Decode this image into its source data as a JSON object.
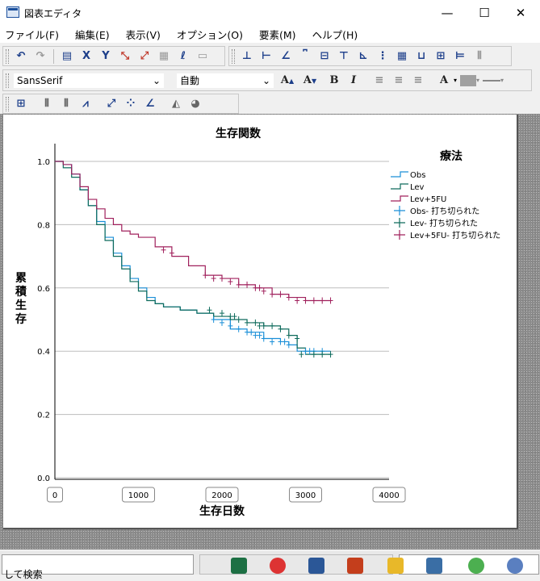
{
  "window": {
    "title": "図表エディタ",
    "min": "—",
    "max": "☐",
    "close": "✕"
  },
  "menu": [
    "ファイル(F)",
    "編集(E)",
    "表示(V)",
    "オプション(O)",
    "要素(M)",
    "ヘルプ(H)"
  ],
  "font_toolbar": {
    "font": "SansSerif",
    "size": "自動",
    "bold": "B",
    "italic": "I",
    "grow": "A",
    "shrink": "A",
    "text_color": "A"
  },
  "taskbar": {
    "search_text": "して検索"
  },
  "colors": {
    "obs": "#1a8fd8",
    "lev": "#0e6b5c",
    "lev5fu": "#a0205c"
  },
  "chart_data": {
    "type": "line",
    "title": "生存関数",
    "xlabel": "生存日数",
    "ylabel": "累積生存",
    "xlim": [
      0,
      4000
    ],
    "ylim": [
      0,
      1.0
    ],
    "xticks": [
      "0",
      "1000",
      "2000",
      "3000",
      "4000"
    ],
    "yticks": [
      "0.0",
      "0.2",
      "0.4",
      "0.6",
      "0.8",
      "1.0"
    ],
    "grid": "horizontal",
    "legend_title": "療法",
    "legend_position": "right",
    "legend": [
      "Obs",
      "Lev",
      "Lev+5FU",
      "Obs- 打ち切られた",
      "Lev- 打ち切られた",
      "Lev+5FU- 打ち切られた"
    ],
    "series": [
      {
        "name": "Obs",
        "color": "#1a8fd8",
        "x": [
          0,
          100,
          200,
          300,
          400,
          500,
          600,
          700,
          800,
          900,
          1000,
          1100,
          1200,
          1300,
          1500,
          1700,
          1900,
          2100,
          2300,
          2500,
          2700,
          2800,
          2900,
          3000,
          3200,
          3300
        ],
        "y": [
          1.0,
          0.99,
          0.96,
          0.91,
          0.86,
          0.81,
          0.76,
          0.71,
          0.67,
          0.63,
          0.6,
          0.57,
          0.55,
          0.54,
          0.53,
          0.52,
          0.5,
          0.47,
          0.46,
          0.44,
          0.43,
          0.42,
          0.4,
          0.4,
          0.4,
          0.4
        ]
      },
      {
        "name": "Lev",
        "color": "#0e6b5c",
        "x": [
          0,
          100,
          200,
          300,
          400,
          500,
          600,
          700,
          800,
          900,
          1000,
          1100,
          1200,
          1300,
          1500,
          1700,
          1900,
          2100,
          2300,
          2500,
          2700,
          2800,
          2900,
          3000,
          3200,
          3300
        ],
        "y": [
          1.0,
          0.98,
          0.95,
          0.91,
          0.86,
          0.8,
          0.75,
          0.7,
          0.66,
          0.62,
          0.59,
          0.56,
          0.55,
          0.54,
          0.53,
          0.52,
          0.51,
          0.5,
          0.49,
          0.48,
          0.47,
          0.45,
          0.41,
          0.39,
          0.39,
          0.39
        ]
      },
      {
        "name": "Lev+5FU",
        "color": "#a0205c",
        "x": [
          0,
          100,
          200,
          300,
          400,
          500,
          600,
          700,
          800,
          900,
          1000,
          1200,
          1400,
          1600,
          1800,
          2000,
          2200,
          2400,
          2600,
          2800,
          3000,
          3200,
          3300
        ],
        "y": [
          1.0,
          0.99,
          0.96,
          0.92,
          0.88,
          0.85,
          0.82,
          0.8,
          0.78,
          0.77,
          0.76,
          0.73,
          0.7,
          0.67,
          0.64,
          0.63,
          0.61,
          0.6,
          0.58,
          0.57,
          0.56,
          0.56,
          0.56
        ]
      }
    ],
    "censored": [
      {
        "name": "Obs- 打ち切られた",
        "color": "#1a8fd8",
        "x": [
          1900,
          2000,
          2100,
          2200,
          2300,
          2350,
          2400,
          2450,
          2500,
          2600,
          2700,
          2750,
          2800,
          3000,
          3050,
          3100,
          3200
        ],
        "y": [
          0.5,
          0.49,
          0.48,
          0.47,
          0.46,
          0.46,
          0.45,
          0.45,
          0.44,
          0.43,
          0.43,
          0.43,
          0.42,
          0.4,
          0.4,
          0.4,
          0.4
        ]
      },
      {
        "name": "Lev- 打ち切られた",
        "color": "#0e6b5c",
        "x": [
          1850,
          2000,
          2100,
          2150,
          2200,
          2300,
          2400,
          2450,
          2500,
          2600,
          2700,
          2800,
          2900,
          2950,
          3100,
          3200,
          3300
        ],
        "y": [
          0.53,
          0.52,
          0.51,
          0.51,
          0.5,
          0.49,
          0.49,
          0.48,
          0.48,
          0.48,
          0.47,
          0.45,
          0.44,
          0.39,
          0.39,
          0.39,
          0.39
        ]
      },
      {
        "name": "Lev+5FU- 打ち切られた",
        "color": "#a0205c",
        "x": [
          1300,
          1400,
          1800,
          1900,
          2000,
          2100,
          2200,
          2300,
          2400,
          2450,
          2500,
          2600,
          2700,
          2800,
          2900,
          3000,
          3100,
          3200,
          3300
        ],
        "y": [
          0.72,
          0.71,
          0.64,
          0.63,
          0.63,
          0.62,
          0.61,
          0.61,
          0.6,
          0.6,
          0.59,
          0.58,
          0.58,
          0.57,
          0.56,
          0.56,
          0.56,
          0.56,
          0.56
        ]
      }
    ]
  }
}
